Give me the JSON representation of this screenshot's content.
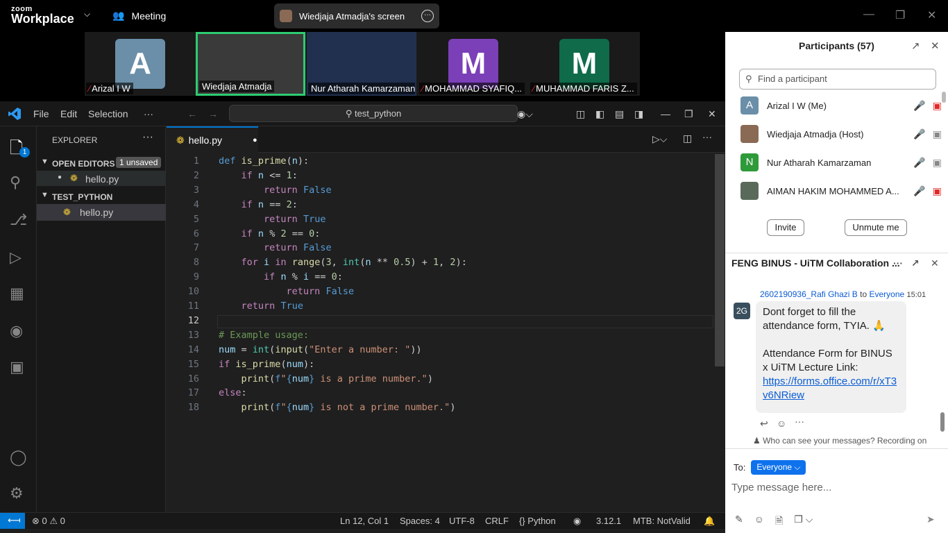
{
  "zoom": {
    "logo_top": "zoom",
    "logo_bottom": "Workplace",
    "meeting_label": "Meeting",
    "share_label": "Wiedjaja Atmadja's screen",
    "tiles": [
      {
        "initial": "A",
        "name": "Arizal I W",
        "color": "#6b8fa8",
        "muted": true
      },
      {
        "initial": "",
        "name": "Wiedjaja Atmadja",
        "color": "#3a3a3a",
        "muted": false
      },
      {
        "initial": "",
        "name": "Nur Atharah Kamarzaman",
        "color": "#21304f",
        "muted": false
      },
      {
        "initial": "M",
        "name": "MOHAMMAD SYAFIQ...",
        "color": "#7b3fb8",
        "muted": true
      },
      {
        "initial": "M",
        "name": "MUHAMMAD FARIS Z...",
        "color": "#0f6b4a",
        "muted": true
      }
    ]
  },
  "vscode": {
    "menus": [
      "File",
      "Edit",
      "Selection",
      "···"
    ],
    "search": "test_python",
    "explorer_title": "EXPLORER",
    "open_editors": "OPEN EDITORS",
    "unsaved_badge": "1 unsaved",
    "open_file": "hello.py",
    "folder": "TEST_PYTHON",
    "folder_file": "hello.py",
    "tab": "hello.py",
    "explorer_badge": "1",
    "status": {
      "errors": "⊗ 0 ⚠ 0",
      "position": "Ln 12, Col 1",
      "spaces": "Spaces: 4",
      "encoding": "UTF-8",
      "eol": "CRLF",
      "language": "{} Python",
      "version": "3.12.1",
      "mtb": "MTB: NotValid"
    }
  },
  "participants": {
    "title": "Participants (57)",
    "find_placeholder": "Find a participant",
    "rows": [
      {
        "initial": "A",
        "name": "Arizal I W (Me)",
        "color": "#6b8fa8"
      },
      {
        "initial": "",
        "name": "Wiedjaja Atmadja (Host)",
        "color": "#8a6a55"
      },
      {
        "initial": "N",
        "name": "Nur Atharah Kamarzaman",
        "color": "#2e9a3a"
      },
      {
        "initial": "",
        "name": "AIMAN HAKIM MOHAMMED A...",
        "color": "#5a6a5a"
      }
    ],
    "invite": "Invite",
    "unmute": "Unmute me"
  },
  "chat": {
    "title": "FENG BINUS - UiTM Collaboration ...",
    "avatar": "2G",
    "sender": "2602190936_Rafi Ghazi B",
    "to_word": "to",
    "recipient": "Everyone",
    "time": "15:01",
    "line1": "Dont forget to fill the attendance form, TYIA. 🙏",
    "line2": "Attendance Form for BINUS x UiTM Lecture Link:",
    "link": "https://forms.office.com/r/xT3v6NRiew",
    "privacy": "Who can see your messages? Recording on",
    "to_label": "To:",
    "to_value": "Everyone",
    "input_placeholder": "Type message here..."
  }
}
